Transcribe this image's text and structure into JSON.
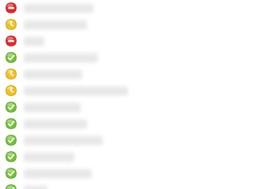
{
  "window": {
    "title": ""
  },
  "status_colors": {
    "busy": "#e8262a",
    "away": "#f2c21b",
    "online": "#74c234"
  },
  "contacts": [
    {
      "status": "busy",
      "icon": "busy-status-icon",
      "name": ""
    },
    {
      "status": "away",
      "icon": "away-status-icon",
      "name": ""
    },
    {
      "status": "busy",
      "icon": "busy-status-icon",
      "name": ""
    },
    {
      "status": "online",
      "icon": "online-status-icon",
      "name": ""
    },
    {
      "status": "away",
      "icon": "away-status-icon",
      "name": ""
    },
    {
      "status": "away",
      "icon": "away-status-icon",
      "name": ""
    },
    {
      "status": "online",
      "icon": "online-status-icon",
      "name": ""
    },
    {
      "status": "online",
      "icon": "online-status-icon",
      "name": ""
    },
    {
      "status": "online",
      "icon": "online-status-icon",
      "name": ""
    },
    {
      "status": "online",
      "icon": "online-status-icon",
      "name": ""
    },
    {
      "status": "online",
      "icon": "online-status-icon",
      "name": ""
    },
    {
      "status": "online",
      "icon": "online-status-icon",
      "name": ""
    }
  ]
}
